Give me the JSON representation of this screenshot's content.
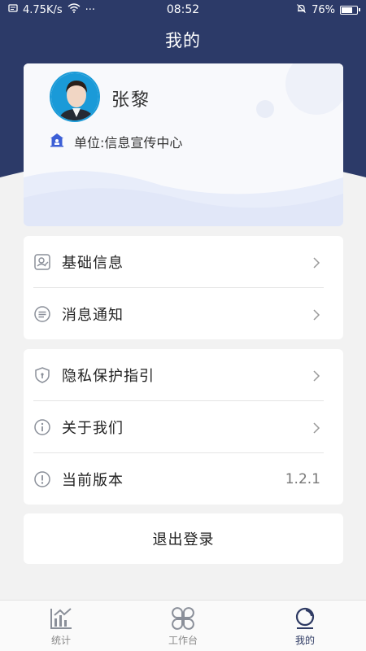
{
  "status_bar": {
    "network_speed": "4.75K/s",
    "more": "···",
    "time": "08:52",
    "battery": "76%",
    "battery_level": 0.76
  },
  "header": {
    "title": "我的"
  },
  "profile": {
    "name": "张黎",
    "unit": "单位:信息宣传中心"
  },
  "menu_group_1": [
    {
      "label": "基础信息",
      "icon": "id-card-icon"
    },
    {
      "label": "消息通知",
      "icon": "message-icon"
    }
  ],
  "menu_group_2": [
    {
      "label": "隐私保护指引",
      "icon": "shield-icon"
    },
    {
      "label": "关于我们",
      "icon": "info-icon"
    },
    {
      "label": "当前版本",
      "icon": "alert-icon",
      "value": "1.2.1"
    }
  ],
  "logout": {
    "label": "退出登录"
  },
  "bottom_nav": [
    {
      "label": "统计",
      "icon": "chart-icon",
      "active": false
    },
    {
      "label": "工作台",
      "icon": "grid-icon",
      "active": false
    },
    {
      "label": "我的",
      "icon": "profile-icon",
      "active": true
    }
  ],
  "colors": {
    "header_bg": "#2c3a68",
    "accent": "#2e3a63",
    "card": "#ffffff",
    "page_bg": "#f2f2f2"
  }
}
